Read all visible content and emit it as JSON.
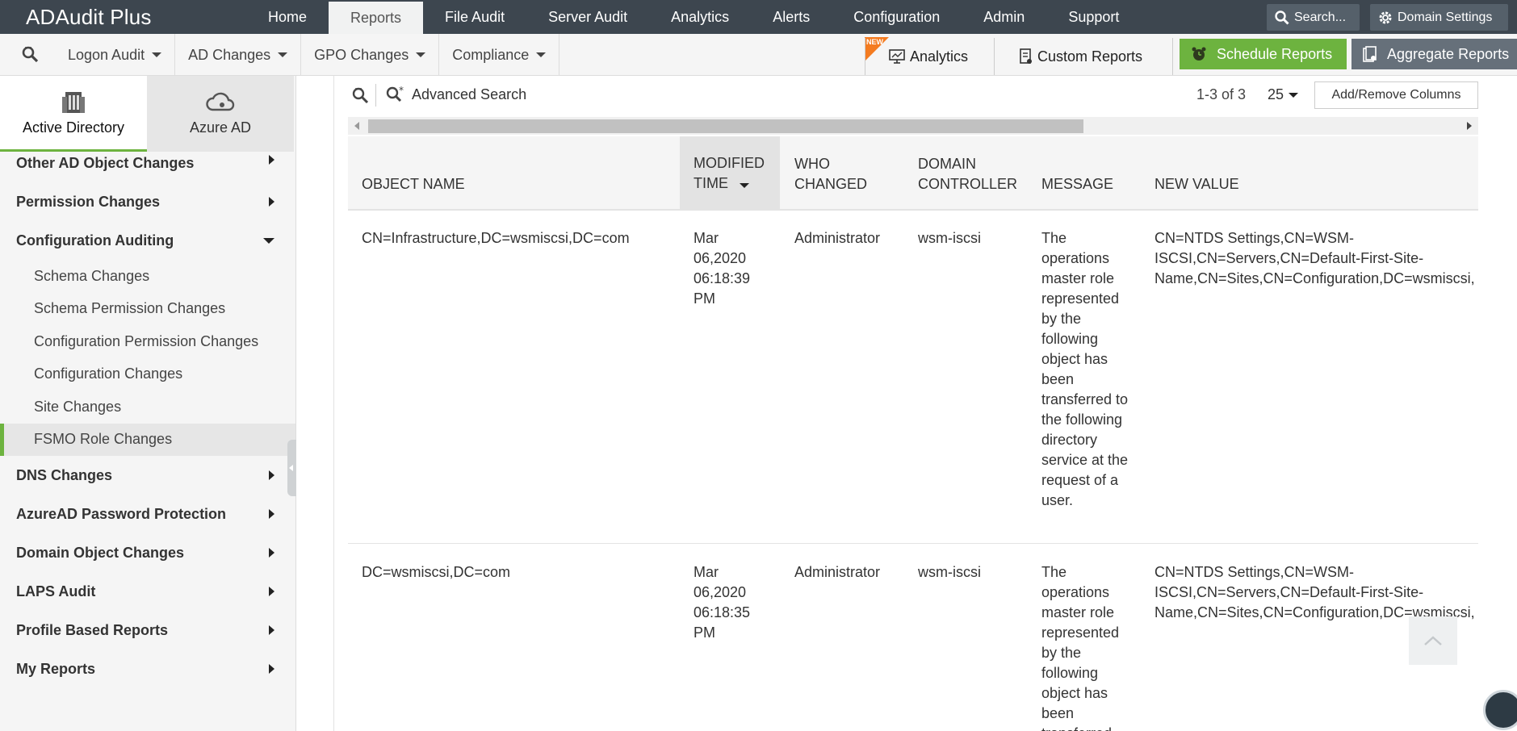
{
  "app": {
    "title": "ADAudit Plus"
  },
  "topnav": {
    "tabs": [
      {
        "label": "Home"
      },
      {
        "label": "Reports"
      },
      {
        "label": "File Audit"
      },
      {
        "label": "Server Audit"
      },
      {
        "label": "Analytics"
      },
      {
        "label": "Alerts"
      },
      {
        "label": "Configuration"
      },
      {
        "label": "Admin"
      },
      {
        "label": "Support"
      }
    ],
    "active_tab": "Reports",
    "search_label": "Search...",
    "domain_settings_label": "Domain Settings"
  },
  "subnav": {
    "menus": [
      {
        "label": "Logon Audit"
      },
      {
        "label": "AD Changes"
      },
      {
        "label": "GPO Changes"
      },
      {
        "label": "Compliance"
      }
    ],
    "new_badge": "NEW",
    "analytics_label": "Analytics",
    "custom_reports_label": "Custom Reports",
    "schedule_reports_label": "Schedule Reports",
    "aggregate_reports_label": "Aggregate Reports"
  },
  "sidebar": {
    "tabs": [
      {
        "label": "Active Directory",
        "icon": "building-icon"
      },
      {
        "label": "Azure AD",
        "icon": "cloud-icon"
      }
    ],
    "categories_top": [
      {
        "label": "Other AD Object Changes"
      },
      {
        "label": "Permission Changes"
      }
    ],
    "expanded": {
      "label": "Configuration Auditing",
      "items": [
        {
          "label": "Schema Changes"
        },
        {
          "label": "Schema Permission Changes"
        },
        {
          "label": "Configuration Permission Changes"
        },
        {
          "label": "Configuration Changes"
        },
        {
          "label": "Site Changes"
        },
        {
          "label": "FSMO Role Changes"
        }
      ],
      "active_item": "FSMO Role Changes"
    },
    "categories_bottom": [
      {
        "label": "DNS Changes"
      },
      {
        "label": "AzureAD Password Protection"
      },
      {
        "label": "Domain Object Changes"
      },
      {
        "label": "LAPS Audit"
      },
      {
        "label": "Profile Based Reports"
      },
      {
        "label": "My Reports"
      }
    ]
  },
  "toolbar": {
    "advanced_search_label": "Advanced Search",
    "pager_text": "1-3 of 3",
    "per_page": "25",
    "add_remove_columns_label": "Add/Remove Columns"
  },
  "table": {
    "columns": [
      {
        "label": "OBJECT NAME"
      },
      {
        "label": "MODIFIED TIME"
      },
      {
        "label": "WHO CHANGED"
      },
      {
        "label": "DOMAIN CONTROLLER"
      },
      {
        "label": "MESSAGE"
      },
      {
        "label": "NEW VALUE"
      }
    ],
    "sorted_column": "MODIFIED TIME",
    "rows": [
      {
        "object_name": "CN=Infrastructure,DC=wsmiscsi,DC=com",
        "modified_time": "Mar 06,2020 06:18:39 PM",
        "who_changed": "Administrator",
        "domain_controller": "wsm-iscsi",
        "message": "The operations master role represented by the following object has been transferred to the following directory service at the request of a user.",
        "new_value": "CN=NTDS Settings,CN=WSM-ISCSI,CN=Servers,CN=Default-First-Site-Name,CN=Sites,CN=Configuration,DC=wsmiscsi,"
      },
      {
        "object_name": "DC=wsmiscsi,DC=com",
        "modified_time": "Mar 06,2020 06:18:35 PM",
        "who_changed": "Administrator",
        "domain_controller": "wsm-iscsi",
        "message": "The operations master role represented by the following object has been transferred",
        "new_value": "CN=NTDS Settings,CN=WSM-ISCSI,CN=Servers,CN=Default-First-Site-Name,CN=Sites,CN=Configuration,DC=wsmiscsi,"
      }
    ]
  },
  "colors": {
    "topbar": "#3d464f",
    "accent_green": "#6db33f",
    "badge_orange": "#f47b20"
  }
}
